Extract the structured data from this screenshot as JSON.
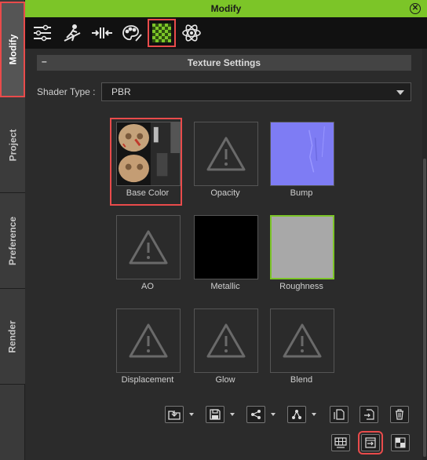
{
  "side_tabs": [
    {
      "label": "Modify",
      "active": true
    },
    {
      "label": "Project",
      "active": false
    },
    {
      "label": "Preference",
      "active": false
    },
    {
      "label": "Render",
      "active": false
    }
  ],
  "title": "Modify",
  "toolbar": {
    "icons": [
      "sliders-icon",
      "motion-icon",
      "morph-icon",
      "palette-icon",
      "checker-texture-icon",
      "atom-icon"
    ],
    "selected_index": 4
  },
  "section": {
    "title": "Texture Settings",
    "collapse_symbol": "–"
  },
  "shader": {
    "label": "Shader Type :",
    "value": "PBR"
  },
  "channels": [
    {
      "label": "Base Color",
      "state": "image"
    },
    {
      "label": "Opacity",
      "state": "missing"
    },
    {
      "label": "Bump",
      "state": "normal-map"
    },
    {
      "label": "AO",
      "state": "missing"
    },
    {
      "label": "Metallic",
      "state": "black"
    },
    {
      "label": "Roughness",
      "state": "gray"
    },
    {
      "label": "Displacement",
      "state": "missing"
    },
    {
      "label": "Glow",
      "state": "missing"
    },
    {
      "label": "Blend",
      "state": "missing"
    }
  ],
  "colors": {
    "accent_green": "#7cc528",
    "highlight_red": "#e94b4b",
    "normal_map": "#7e7cf4",
    "roughness_gray": "#a8a8a8"
  },
  "bottom_buttons": [
    "load-icon",
    "save-icon",
    "share-icon",
    "share-alt-icon",
    "copy-icon",
    "import-icon",
    "delete-icon",
    "grid-icon",
    "export-icon",
    "checker-icon"
  ]
}
